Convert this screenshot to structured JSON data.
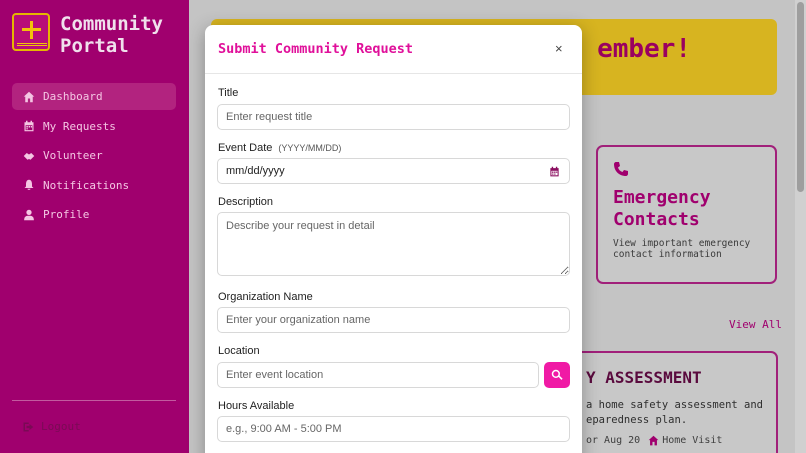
{
  "sidebar": {
    "brand_title": "Community\nPortal",
    "items": [
      {
        "label": "Dashboard",
        "icon": "home-icon",
        "active": true
      },
      {
        "label": "My Requests",
        "icon": "calendar-icon",
        "active": false
      },
      {
        "label": "Volunteer",
        "icon": "handshake-icon",
        "active": false
      },
      {
        "label": "Notifications",
        "icon": "bell-icon",
        "active": false
      },
      {
        "label": "Profile",
        "icon": "user-icon",
        "active": false
      }
    ],
    "logout_label": "Logout"
  },
  "background": {
    "banner_text": "ember!",
    "emergency_card": {
      "title": "Emergency Contacts",
      "description": "View important emergency contact information"
    },
    "view_all_label": "View All",
    "assessment_card": {
      "title": "Y ASSESSMENT",
      "description": "a home safety assessment and\neparedness plan.",
      "date": "or Aug 20",
      "location": "Home Visit"
    }
  },
  "modal": {
    "title": "Submit Community Request",
    "close_label": "×",
    "fields": {
      "title": {
        "label": "Title",
        "placeholder": "Enter request title"
      },
      "event_date": {
        "label": "Event Date",
        "hint": "(YYYY/MM/DD)",
        "value": "mm/dd/yyyy"
      },
      "description": {
        "label": "Description",
        "placeholder": "Describe your request in detail"
      },
      "organization": {
        "label": "Organization Name",
        "placeholder": "Enter your organization name"
      },
      "location": {
        "label": "Location",
        "placeholder": "Enter event location"
      },
      "hours": {
        "label": "Hours Available",
        "placeholder": "e.g., 9:00 AM - 5:00 PM"
      }
    }
  },
  "colors": {
    "sidebar_bg": "#a0006e",
    "accent": "#e0109a",
    "banner": "#d7b420"
  }
}
